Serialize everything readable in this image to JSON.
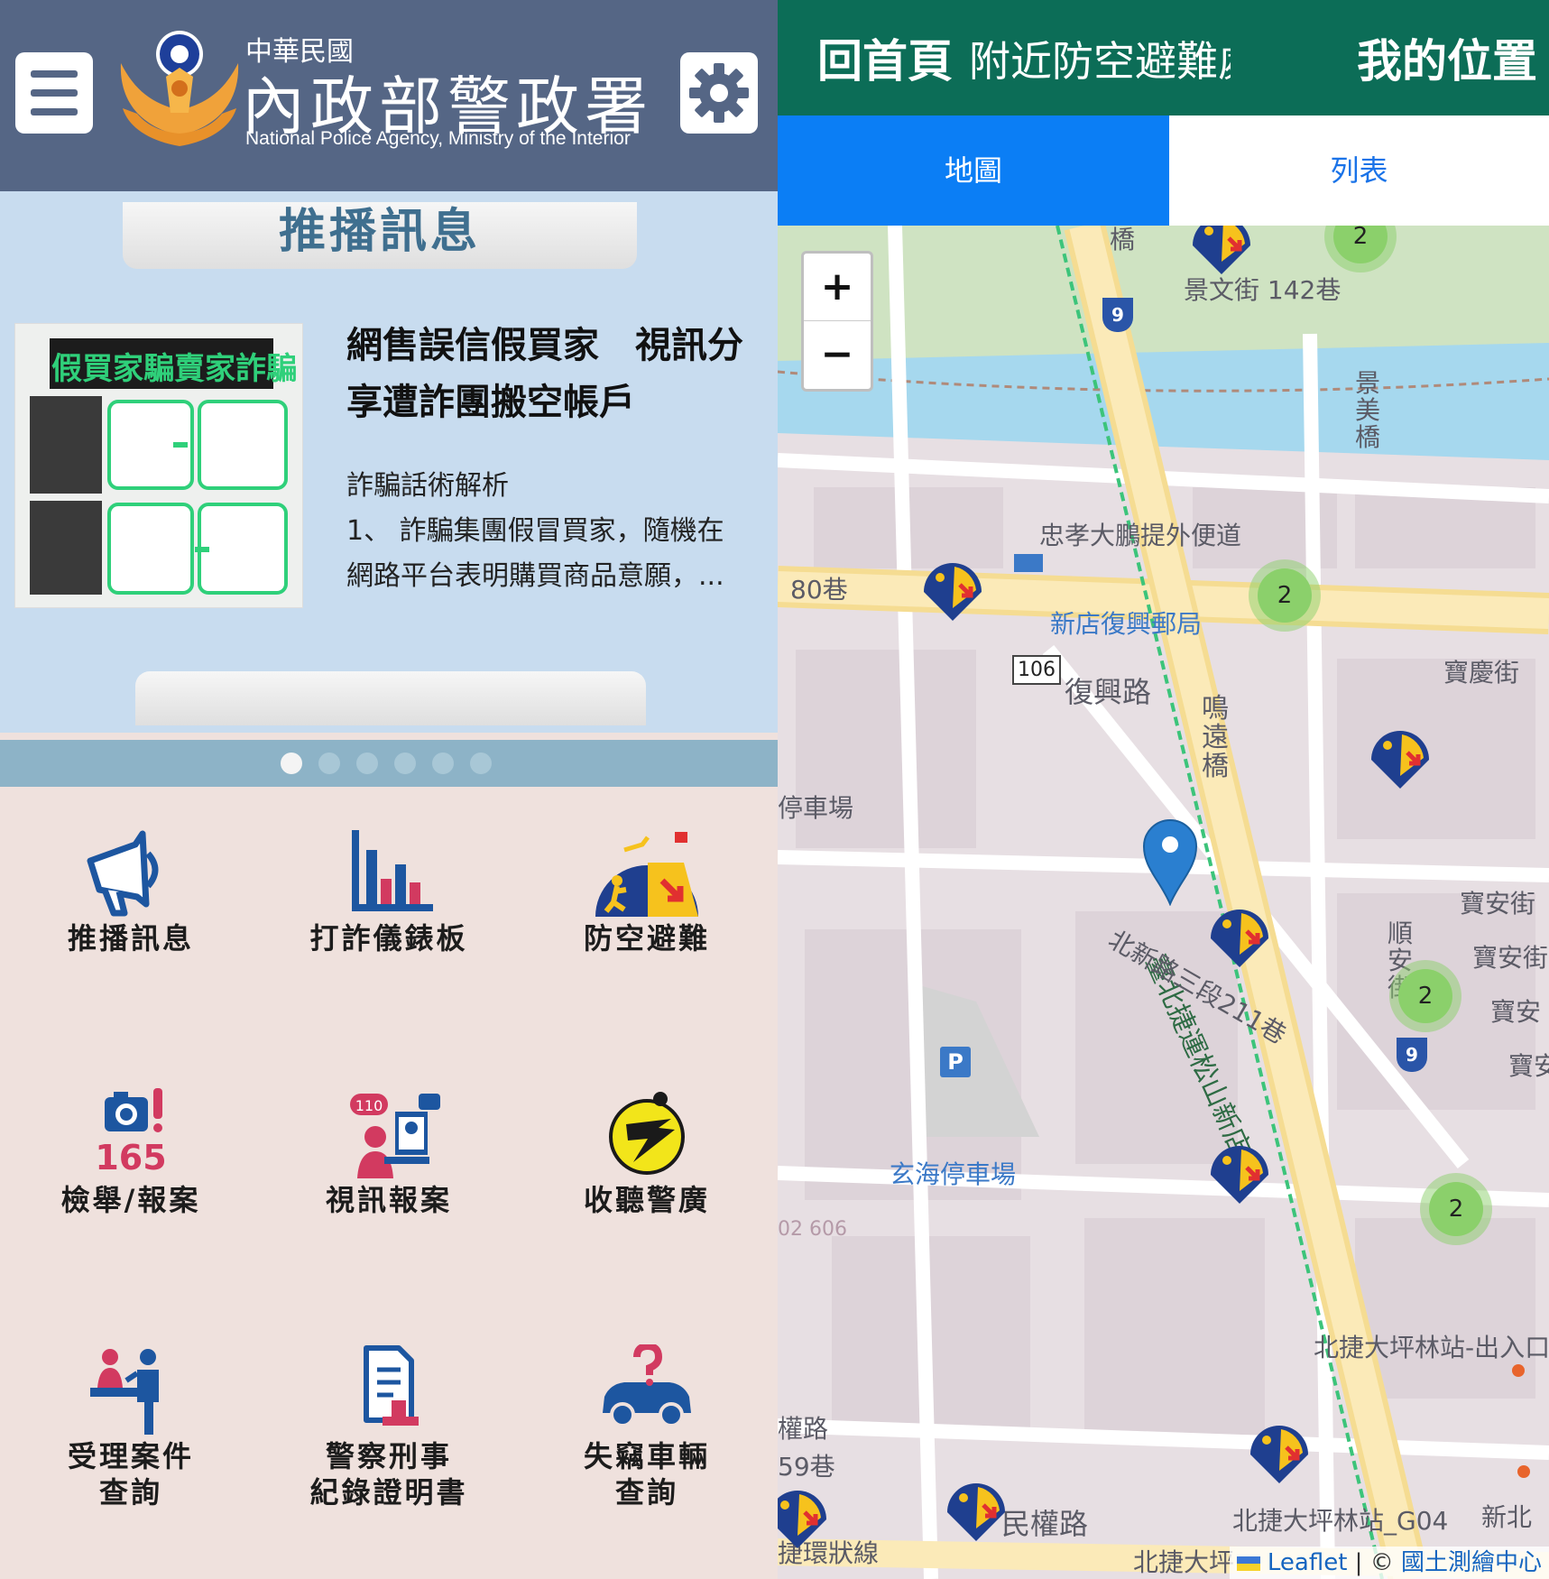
{
  "header": {
    "logo_cn_small": "中華民國",
    "logo_cn_big": "內政部警政署",
    "logo_en": "National Police Agency, Ministry of the Interior"
  },
  "push": {
    "title": "推播訊息",
    "news": {
      "headline": "網售誤信假買家　視訊分享遭詐團搬空帳戶",
      "headline_lines": [
        "網售誤信假買家　視訊分",
        "享遭詐團搬空帳戶"
      ],
      "body_lines": [
        "詐騙話術解析",
        "1、 詐騙集團假冒買家，隨機在",
        "網路平台表明購買商品意願，..."
      ],
      "image_caption": "假買家騙賣家詐騙"
    },
    "dots": 6,
    "active_dot": 0
  },
  "menu": [
    {
      "label": "推播訊息",
      "icon": "megaphone-icon"
    },
    {
      "label": "打詐儀錶板",
      "icon": "bar-chart-icon"
    },
    {
      "label": "防空避難",
      "icon": "air-raid-shelter-icon"
    },
    {
      "label": "檢舉/報案",
      "icon": "camera-165-icon",
      "icon_text": "165"
    },
    {
      "label": "視訊報案",
      "icon": "video-report-icon",
      "icon_text": "110"
    },
    {
      "label": "收聽警廣",
      "icon": "police-radio-icon"
    },
    {
      "label": "受理案件\n查詢",
      "label_lines": [
        "受理案件",
        "查詢"
      ],
      "icon": "case-inquiry-icon"
    },
    {
      "label": "警察刑事\n紀錄證明書",
      "label_lines": [
        "警察刑事",
        "紀錄證明書"
      ],
      "icon": "criminal-record-certificate-icon"
    },
    {
      "label": "失竊車輛\n查詢",
      "label_lines": [
        "失竊車輛",
        "查詢"
      ],
      "icon": "stolen-vehicle-icon"
    }
  ],
  "right": {
    "nav": {
      "home": "回首頁",
      "nearby": "附近防空避難處所",
      "my_location": "我的位置"
    },
    "tabs": {
      "map": "地圖",
      "list": "列表"
    },
    "map": {
      "zoom_in": "+",
      "zoom_out": "−",
      "labels": {
        "jingwen": "景文街 142巷",
        "jingmei_bridge": "景美橋",
        "zhongxiao": "忠孝大鵬提外便道",
        "lane80": "80巷",
        "post_office": "新店復興郵局",
        "route106": "106",
        "fuxing": "復興路",
        "baoqing": "寶慶街",
        "minyuan_bridge": "鳴遠橋",
        "parking1": "停車場",
        "baoan1": "寶安街",
        "baoan2": "寶安街",
        "baoan3": "寶安",
        "baoan4": "寶安",
        "shunan": "順安街",
        "mrt_line": "臺北捷運松山新店線",
        "beixin": "北新路三段211巷",
        "xuanhai": "玄海停車場",
        "num606": "02 606",
        "station_exit": "北捷大坪林站-出入口",
        "minquan_road1": "權路",
        "lane59": "59巷",
        "minquan": "民權路",
        "station_g04": "北捷大坪林站_G04",
        "bei": "新北",
        "ring": "捷環狀線",
        "dapinglin": "北捷大坪",
        "route9_a": "9",
        "route9_b": "9",
        "parking_p": "P",
        "qiao": "橋"
      },
      "clusters": [
        "2",
        "2",
        "2",
        "2"
      ],
      "attribution_leaflet": "Leaflet",
      "attribution_sep": " | © ",
      "attribution_source": "國土測繪中心"
    }
  },
  "colors": {
    "header_bg": "#556685",
    "carousel_bg": "#c8dcef",
    "menu_bg": "#efe1dd",
    "nav_green": "#0c6d57",
    "tab_active": "#0b7ef5",
    "cluster": "#8bd06b",
    "shelter_marker": "#f5c400"
  }
}
